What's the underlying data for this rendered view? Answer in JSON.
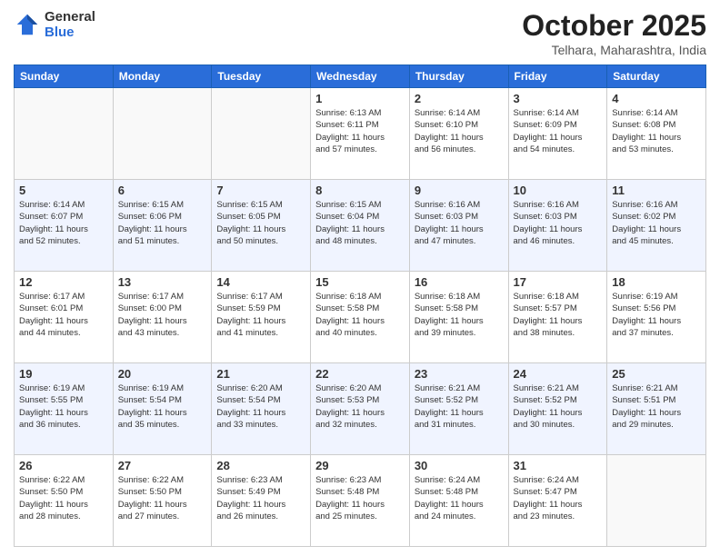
{
  "logo": {
    "line1": "General",
    "line2": "Blue"
  },
  "header": {
    "month": "October 2025",
    "location": "Telhara, Maharashtra, India"
  },
  "weekdays": [
    "Sunday",
    "Monday",
    "Tuesday",
    "Wednesday",
    "Thursday",
    "Friday",
    "Saturday"
  ],
  "weeks": [
    [
      {
        "day": "",
        "info": ""
      },
      {
        "day": "",
        "info": ""
      },
      {
        "day": "",
        "info": ""
      },
      {
        "day": "1",
        "info": "Sunrise: 6:13 AM\nSunset: 6:11 PM\nDaylight: 11 hours\nand 57 minutes."
      },
      {
        "day": "2",
        "info": "Sunrise: 6:14 AM\nSunset: 6:10 PM\nDaylight: 11 hours\nand 56 minutes."
      },
      {
        "day": "3",
        "info": "Sunrise: 6:14 AM\nSunset: 6:09 PM\nDaylight: 11 hours\nand 54 minutes."
      },
      {
        "day": "4",
        "info": "Sunrise: 6:14 AM\nSunset: 6:08 PM\nDaylight: 11 hours\nand 53 minutes."
      }
    ],
    [
      {
        "day": "5",
        "info": "Sunrise: 6:14 AM\nSunset: 6:07 PM\nDaylight: 11 hours\nand 52 minutes."
      },
      {
        "day": "6",
        "info": "Sunrise: 6:15 AM\nSunset: 6:06 PM\nDaylight: 11 hours\nand 51 minutes."
      },
      {
        "day": "7",
        "info": "Sunrise: 6:15 AM\nSunset: 6:05 PM\nDaylight: 11 hours\nand 50 minutes."
      },
      {
        "day": "8",
        "info": "Sunrise: 6:15 AM\nSunset: 6:04 PM\nDaylight: 11 hours\nand 48 minutes."
      },
      {
        "day": "9",
        "info": "Sunrise: 6:16 AM\nSunset: 6:03 PM\nDaylight: 11 hours\nand 47 minutes."
      },
      {
        "day": "10",
        "info": "Sunrise: 6:16 AM\nSunset: 6:03 PM\nDaylight: 11 hours\nand 46 minutes."
      },
      {
        "day": "11",
        "info": "Sunrise: 6:16 AM\nSunset: 6:02 PM\nDaylight: 11 hours\nand 45 minutes."
      }
    ],
    [
      {
        "day": "12",
        "info": "Sunrise: 6:17 AM\nSunset: 6:01 PM\nDaylight: 11 hours\nand 44 minutes."
      },
      {
        "day": "13",
        "info": "Sunrise: 6:17 AM\nSunset: 6:00 PM\nDaylight: 11 hours\nand 43 minutes."
      },
      {
        "day": "14",
        "info": "Sunrise: 6:17 AM\nSunset: 5:59 PM\nDaylight: 11 hours\nand 41 minutes."
      },
      {
        "day": "15",
        "info": "Sunrise: 6:18 AM\nSunset: 5:58 PM\nDaylight: 11 hours\nand 40 minutes."
      },
      {
        "day": "16",
        "info": "Sunrise: 6:18 AM\nSunset: 5:58 PM\nDaylight: 11 hours\nand 39 minutes."
      },
      {
        "day": "17",
        "info": "Sunrise: 6:18 AM\nSunset: 5:57 PM\nDaylight: 11 hours\nand 38 minutes."
      },
      {
        "day": "18",
        "info": "Sunrise: 6:19 AM\nSunset: 5:56 PM\nDaylight: 11 hours\nand 37 minutes."
      }
    ],
    [
      {
        "day": "19",
        "info": "Sunrise: 6:19 AM\nSunset: 5:55 PM\nDaylight: 11 hours\nand 36 minutes."
      },
      {
        "day": "20",
        "info": "Sunrise: 6:19 AM\nSunset: 5:54 PM\nDaylight: 11 hours\nand 35 minutes."
      },
      {
        "day": "21",
        "info": "Sunrise: 6:20 AM\nSunset: 5:54 PM\nDaylight: 11 hours\nand 33 minutes."
      },
      {
        "day": "22",
        "info": "Sunrise: 6:20 AM\nSunset: 5:53 PM\nDaylight: 11 hours\nand 32 minutes."
      },
      {
        "day": "23",
        "info": "Sunrise: 6:21 AM\nSunset: 5:52 PM\nDaylight: 11 hours\nand 31 minutes."
      },
      {
        "day": "24",
        "info": "Sunrise: 6:21 AM\nSunset: 5:52 PM\nDaylight: 11 hours\nand 30 minutes."
      },
      {
        "day": "25",
        "info": "Sunrise: 6:21 AM\nSunset: 5:51 PM\nDaylight: 11 hours\nand 29 minutes."
      }
    ],
    [
      {
        "day": "26",
        "info": "Sunrise: 6:22 AM\nSunset: 5:50 PM\nDaylight: 11 hours\nand 28 minutes."
      },
      {
        "day": "27",
        "info": "Sunrise: 6:22 AM\nSunset: 5:50 PM\nDaylight: 11 hours\nand 27 minutes."
      },
      {
        "day": "28",
        "info": "Sunrise: 6:23 AM\nSunset: 5:49 PM\nDaylight: 11 hours\nand 26 minutes."
      },
      {
        "day": "29",
        "info": "Sunrise: 6:23 AM\nSunset: 5:48 PM\nDaylight: 11 hours\nand 25 minutes."
      },
      {
        "day": "30",
        "info": "Sunrise: 6:24 AM\nSunset: 5:48 PM\nDaylight: 11 hours\nand 24 minutes."
      },
      {
        "day": "31",
        "info": "Sunrise: 6:24 AM\nSunset: 5:47 PM\nDaylight: 11 hours\nand 23 minutes."
      },
      {
        "day": "",
        "info": ""
      }
    ]
  ]
}
